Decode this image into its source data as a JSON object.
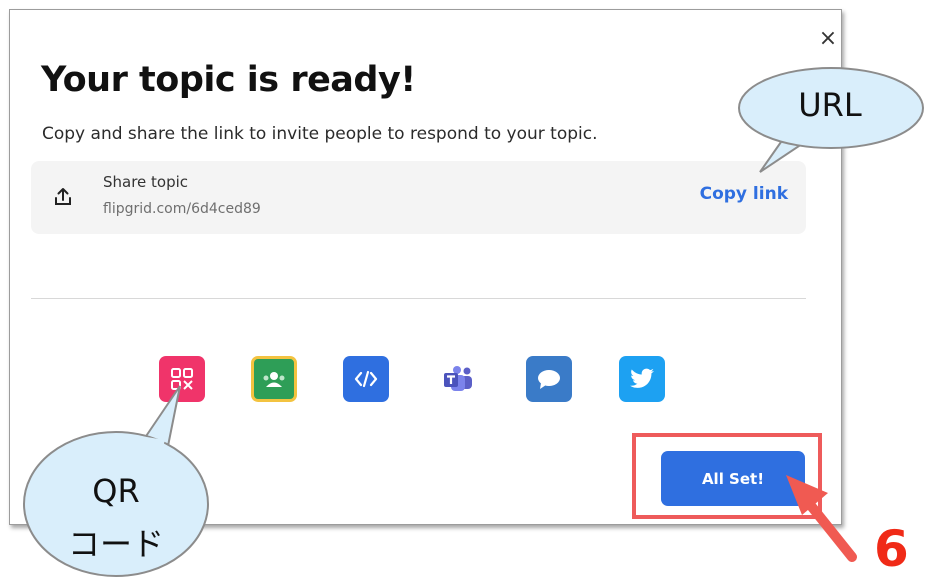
{
  "dialog": {
    "close_glyph": "×",
    "title": "Your topic is ready!",
    "subtitle": "Copy and share the link to invite people to respond to your topic."
  },
  "share": {
    "title": "Share topic",
    "url": "flipgrid.com/6d4ced89",
    "copy_label": "Copy link"
  },
  "share_options": [
    {
      "icon": "qr-code-icon",
      "color": "#f0346a"
    },
    {
      "icon": "google-classroom-icon",
      "color": "#2e9e57"
    },
    {
      "icon": "embed-code-icon",
      "color": "#2f6fe0"
    },
    {
      "icon": "microsoft-teams-icon",
      "color": "#ffffff"
    },
    {
      "icon": "remind-chat-icon",
      "color": "#3a7bc8"
    },
    {
      "icon": "twitter-icon",
      "color": "#1da1f2"
    }
  ],
  "actions": {
    "all_set_label": "All Set!"
  },
  "annotations": {
    "url_callout": "URL",
    "qr_callout_line1": "QR",
    "qr_callout_line2": "コード",
    "step_number": "6",
    "highlight_color": "#ee5b5b",
    "callout_fill": "#d9eefb"
  }
}
